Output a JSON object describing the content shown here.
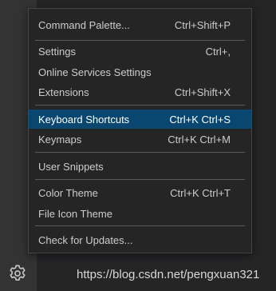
{
  "menu": {
    "items": [
      {
        "label": "Command Palette...",
        "shortcut": "Ctrl+Shift+P"
      },
      {
        "label": "Settings",
        "shortcut": "Ctrl+,"
      },
      {
        "label": "Online Services Settings",
        "shortcut": ""
      },
      {
        "label": "Extensions",
        "shortcut": "Ctrl+Shift+X"
      },
      {
        "label": "Keyboard Shortcuts",
        "shortcut": "Ctrl+K Ctrl+S"
      },
      {
        "label": "Keymaps",
        "shortcut": "Ctrl+K Ctrl+M"
      },
      {
        "label": "User Snippets",
        "shortcut": ""
      },
      {
        "label": "Color Theme",
        "shortcut": "Ctrl+K Ctrl+T"
      },
      {
        "label": "File Icon Theme",
        "shortcut": ""
      },
      {
        "label": "Check for Updates...",
        "shortcut": ""
      }
    ],
    "highlight_color": "#094771"
  },
  "activity_bar": {
    "manage_icon": "gear-icon"
  },
  "watermark": {
    "text": "https://blog.csdn.net/pengxuan321"
  }
}
